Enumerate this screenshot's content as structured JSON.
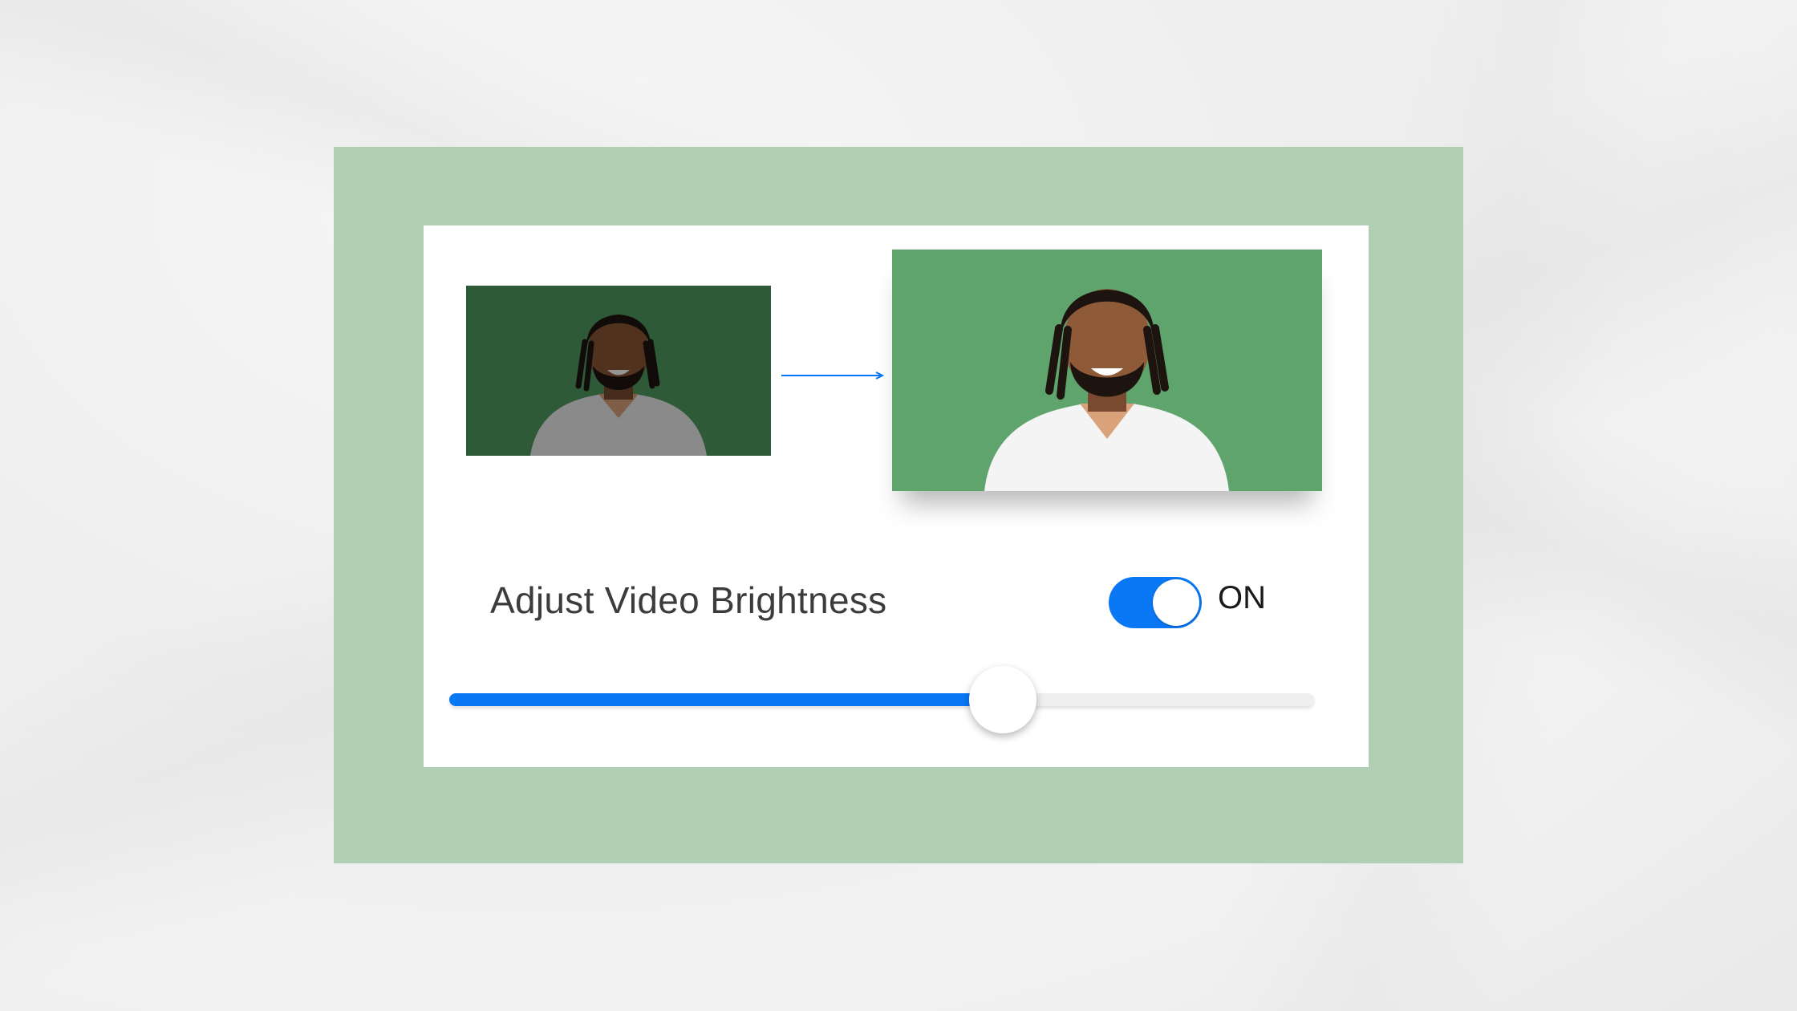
{
  "settings": {
    "title": "Adjust Video Brightness",
    "toggle_label": "ON",
    "toggle_on": true,
    "brightness_fraction": 0.64
  },
  "colors": {
    "accent": "#0a78f5",
    "frame": "#b1cfb4",
    "screen_before": "#2f5c3a",
    "screen_after": "#5fa46c"
  },
  "icons": {
    "arrow": "arrow-right-icon",
    "slider_thumb": "slider-thumb"
  }
}
